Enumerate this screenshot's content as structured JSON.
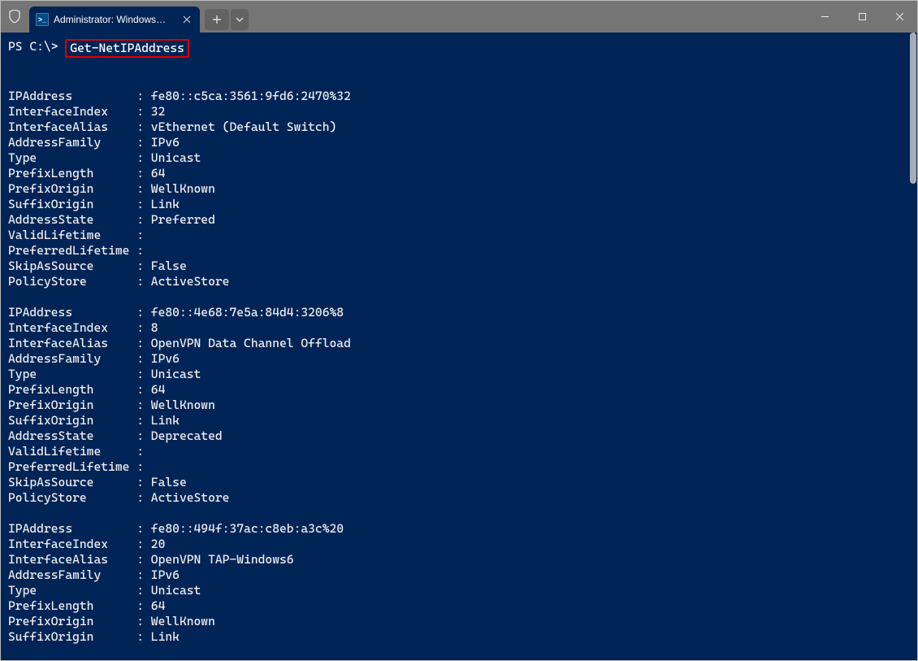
{
  "tab": {
    "title": "Administrator: Windows Powe"
  },
  "prompt": "PS C:\\>",
  "command": "Get-NetIPAddress",
  "blocks": [
    {
      "rows": [
        {
          "key": "IPAddress",
          "val": "fe80::c5ca:3561:9fd6:2470%32"
        },
        {
          "key": "InterfaceIndex",
          "val": "32"
        },
        {
          "key": "InterfaceAlias",
          "val": "vEthernet (Default Switch)"
        },
        {
          "key": "AddressFamily",
          "val": "IPv6"
        },
        {
          "key": "Type",
          "val": "Unicast"
        },
        {
          "key": "PrefixLength",
          "val": "64"
        },
        {
          "key": "PrefixOrigin",
          "val": "WellKnown"
        },
        {
          "key": "SuffixOrigin",
          "val": "Link"
        },
        {
          "key": "AddressState",
          "val": "Preferred"
        },
        {
          "key": "ValidLifetime",
          "val": ""
        },
        {
          "key": "PreferredLifetime",
          "val": ""
        },
        {
          "key": "SkipAsSource",
          "val": "False"
        },
        {
          "key": "PolicyStore",
          "val": "ActiveStore"
        }
      ]
    },
    {
      "rows": [
        {
          "key": "IPAddress",
          "val": "fe80::4e68:7e5a:84d4:3206%8"
        },
        {
          "key": "InterfaceIndex",
          "val": "8"
        },
        {
          "key": "InterfaceAlias",
          "val": "OpenVPN Data Channel Offload"
        },
        {
          "key": "AddressFamily",
          "val": "IPv6"
        },
        {
          "key": "Type",
          "val": "Unicast"
        },
        {
          "key": "PrefixLength",
          "val": "64"
        },
        {
          "key": "PrefixOrigin",
          "val": "WellKnown"
        },
        {
          "key": "SuffixOrigin",
          "val": "Link"
        },
        {
          "key": "AddressState",
          "val": "Deprecated"
        },
        {
          "key": "ValidLifetime",
          "val": ""
        },
        {
          "key": "PreferredLifetime",
          "val": ""
        },
        {
          "key": "SkipAsSource",
          "val": "False"
        },
        {
          "key": "PolicyStore",
          "val": "ActiveStore"
        }
      ]
    },
    {
      "rows": [
        {
          "key": "IPAddress",
          "val": "fe80::494f:37ac:c8eb:a3c%20"
        },
        {
          "key": "InterfaceIndex",
          "val": "20"
        },
        {
          "key": "InterfaceAlias",
          "val": "OpenVPN TAP-Windows6"
        },
        {
          "key": "AddressFamily",
          "val": "IPv6"
        },
        {
          "key": "Type",
          "val": "Unicast"
        },
        {
          "key": "PrefixLength",
          "val": "64"
        },
        {
          "key": "PrefixOrigin",
          "val": "WellKnown"
        },
        {
          "key": "SuffixOrigin",
          "val": "Link"
        }
      ]
    }
  ]
}
